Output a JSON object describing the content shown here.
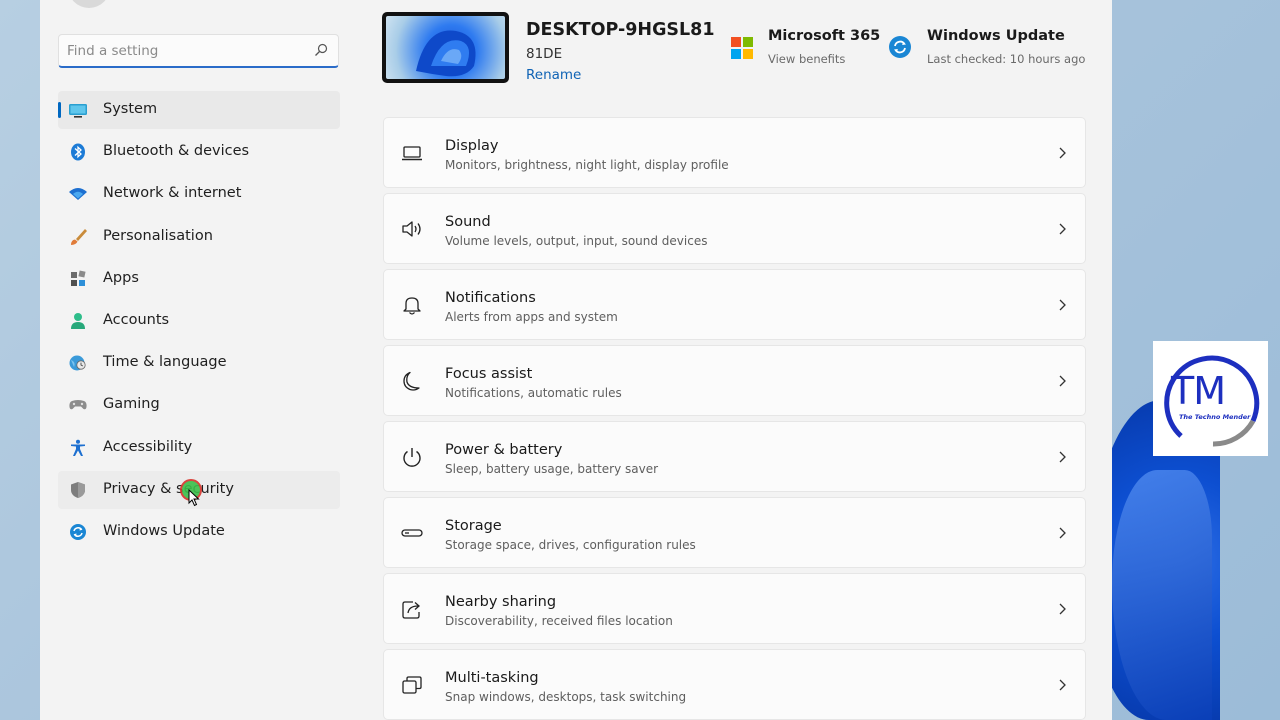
{
  "search": {
    "placeholder": "Find a setting",
    "value": ""
  },
  "sidebar": {
    "items": [
      {
        "label": "System",
        "icon": "monitor-icon",
        "selected": true
      },
      {
        "label": "Bluetooth & devices",
        "icon": "bluetooth-icon"
      },
      {
        "label": "Network & internet",
        "icon": "wifi-icon"
      },
      {
        "label": "Personalisation",
        "icon": "brush-icon"
      },
      {
        "label": "Apps",
        "icon": "apps-icon"
      },
      {
        "label": "Accounts",
        "icon": "person-icon"
      },
      {
        "label": "Time & language",
        "icon": "globe-clock-icon"
      },
      {
        "label": "Gaming",
        "icon": "gamepad-icon"
      },
      {
        "label": "Accessibility",
        "icon": "accessibility-icon"
      },
      {
        "label": "Privacy & security",
        "icon": "shield-icon",
        "hovered": true
      },
      {
        "label": "Windows Update",
        "icon": "refresh-icon"
      }
    ]
  },
  "device": {
    "name": "DESKTOP-9HGSL81",
    "model": "81DE",
    "rename_label": "Rename"
  },
  "widgets": {
    "microsoft365": {
      "title": "Microsoft 365",
      "subtitle": "View benefits",
      "icon": "microsoft-logo-icon"
    },
    "windows_update": {
      "title": "Windows Update",
      "subtitle": "Last checked: 10 hours ago",
      "icon": "sync-icon"
    }
  },
  "cards": [
    {
      "title": "Display",
      "subtitle": "Monitors, brightness, night light, display profile",
      "icon": "laptop-icon"
    },
    {
      "title": "Sound",
      "subtitle": "Volume levels, output, input, sound devices",
      "icon": "speaker-icon"
    },
    {
      "title": "Notifications",
      "subtitle": "Alerts from apps and system",
      "icon": "bell-icon"
    },
    {
      "title": "Focus assist",
      "subtitle": "Notifications, automatic rules",
      "icon": "moon-icon"
    },
    {
      "title": "Power & battery",
      "subtitle": "Sleep, battery usage, battery saver",
      "icon": "power-icon"
    },
    {
      "title": "Storage",
      "subtitle": "Storage space, drives, configuration rules",
      "icon": "drive-icon"
    },
    {
      "title": "Nearby sharing",
      "subtitle": "Discoverability, received files location",
      "icon": "share-icon"
    },
    {
      "title": "Multi-tasking",
      "subtitle": "Snap windows, desktops, task switching",
      "icon": "multitask-icon"
    }
  ],
  "watermark": {
    "initials": "TM",
    "caption": "The Techno Mender"
  },
  "colors": {
    "accent": "#0067c0",
    "link": "#0f63b5",
    "window_bg": "#f3f3f3",
    "card_bg": "#fbfbfb"
  }
}
